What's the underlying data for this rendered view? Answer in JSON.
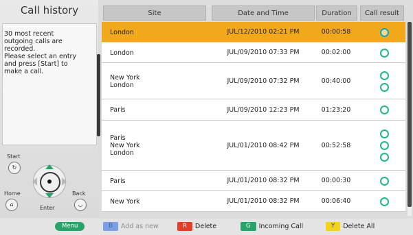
{
  "left": {
    "title": "Call history",
    "info": "30 most recent\noutgoing calls are\nrecorded.\nPlease select an entry\nand press [Start] to\nmake a call.",
    "controls": {
      "start": "Start",
      "home": "Home",
      "back": "Back",
      "enter": "Enter"
    }
  },
  "table": {
    "headers": {
      "site": "Site",
      "date": "Date and Time",
      "duration": "Duration",
      "result": "Call result"
    },
    "rows": [
      {
        "site": "London",
        "date": "JUL/12/2010 02:21 PM",
        "duration": "00:00:58",
        "results": 1,
        "selected": true
      },
      {
        "site": "London",
        "date": "JUL/09/2010 07:33 PM",
        "duration": "00:02:00",
        "results": 1
      },
      {
        "site": "New York\nLondon",
        "date": "JUL/09/2010 07:32 PM",
        "duration": "00:40:00",
        "results": 2
      },
      {
        "site": "Paris",
        "date": "JUL/09/2010 12:23 PM",
        "duration": "01:23:20",
        "results": 1
      },
      {
        "site": "Paris\nNew York\nLondon",
        "date": "JUL/01/2010 08:42 PM",
        "duration": "00:52:58",
        "results": 3
      },
      {
        "site": "Paris",
        "date": "JUL/01/2010 08:32 PM",
        "duration": "00:00:30",
        "results": 1
      },
      {
        "site": "New York",
        "date": "JUL/01/2010 08:32 PM",
        "duration": "00:06:40",
        "results": 1
      }
    ]
  },
  "bottom": {
    "menu": "Menu",
    "add": {
      "key": "B",
      "label": "Add as new"
    },
    "delete": {
      "key": "R",
      "label": "Delete"
    },
    "incoming": {
      "key": "G",
      "label": "Incoming Call"
    },
    "delete_all": {
      "key": "Y",
      "label": "Delete All"
    }
  },
  "colors": {
    "selected": "#f1a81b",
    "result_circle": "#20b88a",
    "b": "#3c6fd6",
    "r": "#e0402a",
    "g": "#2aa36b",
    "y": "#f4d21c"
  }
}
